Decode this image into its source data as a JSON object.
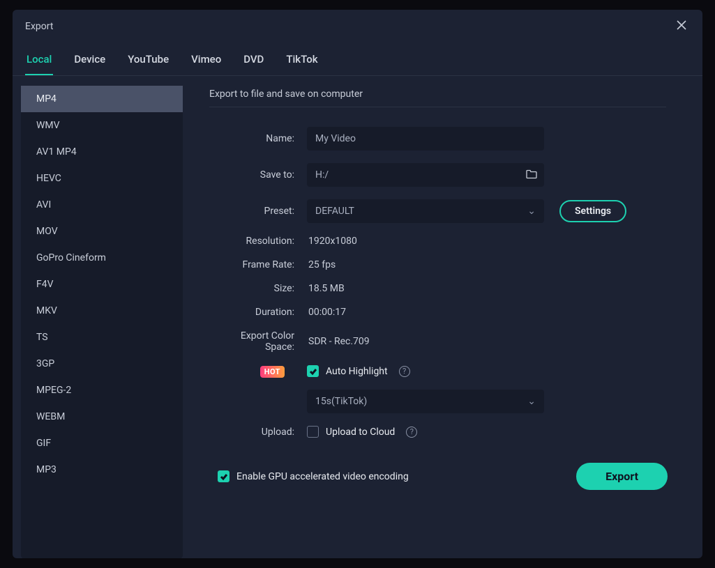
{
  "dialog": {
    "title": "Export"
  },
  "tabs": [
    "Local",
    "Device",
    "YouTube",
    "Vimeo",
    "DVD",
    "TikTok"
  ],
  "formats": [
    "MP4",
    "WMV",
    "AV1 MP4",
    "HEVC",
    "AVI",
    "MOV",
    "GoPro Cineform",
    "F4V",
    "MKV",
    "TS",
    "3GP",
    "MPEG-2",
    "WEBM",
    "GIF",
    "MP3"
  ],
  "section": {
    "title": "Export to file and save on computer"
  },
  "labels": {
    "name": "Name:",
    "save_to": "Save to:",
    "preset": "Preset:",
    "resolution": "Resolution:",
    "frame_rate": "Frame Rate:",
    "size": "Size:",
    "duration": "Duration:",
    "color_space": "Export Color Space:",
    "upload": "Upload:"
  },
  "values": {
    "name": "My Video",
    "save_to": "H:/",
    "preset": "DEFAULT",
    "resolution": "1920x1080",
    "frame_rate": "25 fps",
    "size": "18.5 MB",
    "duration": "00:00:17",
    "color_space": "SDR - Rec.709",
    "highlight_preset": "15s(TikTok)"
  },
  "badges": {
    "hot": "HOT"
  },
  "checks": {
    "auto_highlight": "Auto Highlight",
    "upload_cloud": "Upload to Cloud",
    "gpu": "Enable GPU accelerated video encoding"
  },
  "buttons": {
    "settings": "Settings",
    "export": "Export"
  }
}
